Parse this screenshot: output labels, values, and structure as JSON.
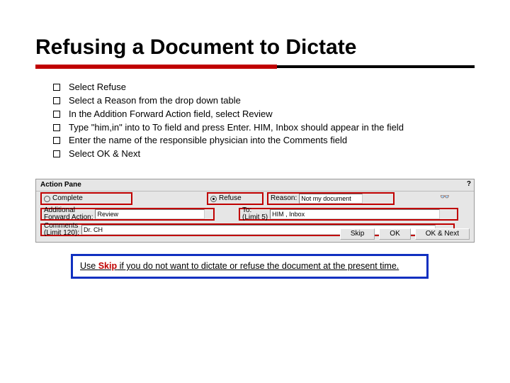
{
  "title": "Refusing a Document to Dictate",
  "bullets": [
    "Select Refuse",
    "Select a Reason from the drop down table",
    "In the Addition Forward Action field, select Review",
    "Type \"him,in\" into to To field and press Enter. HIM, Inbox should appear in the field",
    "Enter the name of the responsible physician into the Comments field",
    "Select OK & Next"
  ],
  "pane": {
    "title": "Action Pane",
    "arrow": "?",
    "complete_label": "Complete",
    "refuse_label": "Refuse",
    "reason_label": "Reason:",
    "reason_value": "Not my document",
    "addforward_label1": "Additional",
    "addforward_label2": "Forward Action:",
    "addforward_value": "Review",
    "to_label1": "To:",
    "to_label2": "(Limit 5)",
    "to_value": "HIM , Inbox",
    "glasses": "👓",
    "comments_label1": "Comments",
    "comments_label2": "(Limit 120):",
    "comments_value": "Dr. CH",
    "btn_skip": "Skip",
    "btn_ok": "OK",
    "btn_oknext": "OK & Next"
  },
  "note_pre": "Use ",
  "note_skip": "Skip",
  "note_post": " if you do not want to dictate or refuse the document at the present time."
}
